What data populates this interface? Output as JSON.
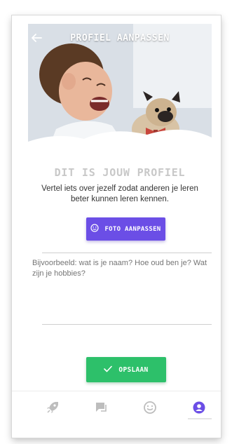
{
  "header": {
    "title": "PROFIEL AANPASSEN"
  },
  "profile": {
    "heading": "DIT IS JOUW PROFIEL",
    "description": "Vertel iets over jezelf zodat anderen je leren beter kunnen leren kennen.",
    "photo_button_label": "FOTO AANPASSEN"
  },
  "bio": {
    "placeholder": "Bijvoorbeeld: wat is je naam? Hoe oud ben je? Wat zijn je hobbies?"
  },
  "actions": {
    "save_label": "OPSLAAN"
  },
  "nav": {
    "items": [
      {
        "icon": "rocket-icon",
        "active": false
      },
      {
        "icon": "chat-icon",
        "active": false
      },
      {
        "icon": "smiley-icon",
        "active": false
      },
      {
        "icon": "profile-icon",
        "active": true
      }
    ]
  },
  "colors": {
    "accent_purple": "#6b4ee6",
    "save_green": "#2dc06a",
    "inactive_icon": "#bdbdbd",
    "active_icon": "#6b4ee6"
  }
}
